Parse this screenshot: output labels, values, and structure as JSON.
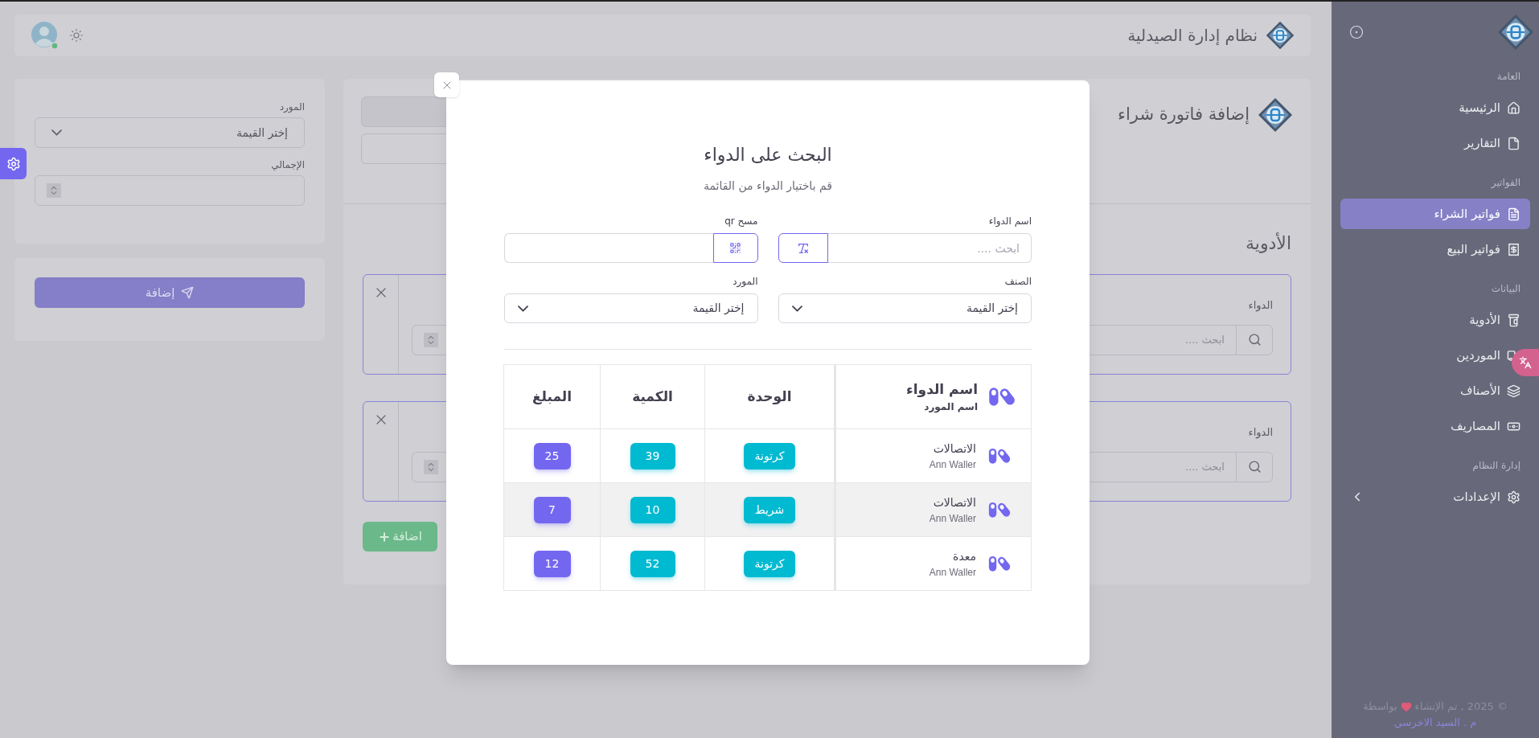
{
  "header": {
    "title": "نظام إدارة الصيدلية"
  },
  "sidebar": {
    "sections": [
      {
        "title": "العامة",
        "items": [
          {
            "label": "الرئيسية",
            "selected": false
          },
          {
            "label": "التقارير",
            "selected": false
          }
        ]
      },
      {
        "title": "الفواتير",
        "items": [
          {
            "label": "فواتير الشراء",
            "selected": true
          },
          {
            "label": "فواتير البيع",
            "selected": false
          }
        ]
      },
      {
        "title": "البيانات",
        "items": [
          {
            "label": "الأدوية",
            "selected": false
          },
          {
            "label": "الموردين",
            "selected": false
          },
          {
            "label": "الأصناف",
            "selected": false
          },
          {
            "label": "المصاريف",
            "selected": false
          }
        ]
      },
      {
        "title": "إدارة النظام",
        "items": [
          {
            "label": "الإعدادات",
            "selected": false,
            "expandable": true
          }
        ]
      }
    ],
    "footer": {
      "before": "© 2025 , تم الإنشاء",
      "after": "بواسطة",
      "author": "م . السيد الاخرسي"
    }
  },
  "left_panel": {
    "fields": [
      {
        "kind": "select",
        "label": "المورد",
        "value": "إختر القيمة"
      },
      {
        "kind": "number",
        "label": "الإجمالي"
      }
    ],
    "submit": "إضافة"
  },
  "invoice": {
    "title": "إضافة فاتورة شراء",
    "section_title": "الأدوية",
    "items": [
      {
        "label": "الدواء",
        "placeholder": "ابحث ...."
      },
      {
        "label": "الدواء",
        "placeholder": "ابحث ...."
      }
    ],
    "add_button": "اضافة"
  },
  "modal": {
    "title": "البحث على الدواء",
    "subtitle": "قم باختيار الدواء من القائمة",
    "fields": [
      {
        "kind": "search",
        "label": "اسم الدواء",
        "placeholder": "ابحث ...."
      },
      {
        "kind": "qr",
        "label": "مسح qr"
      },
      {
        "kind": "select",
        "label": "الصنف",
        "value": "إختر القيمة"
      },
      {
        "kind": "select",
        "label": "المورد",
        "value": "إختر القيمة"
      }
    ],
    "table": {
      "columns": [
        {
          "title": "اسم الدواء",
          "subtitle": "اسم المورد"
        },
        {
          "title": "الوحدة"
        },
        {
          "title": "الكمية"
        },
        {
          "title": "المبلغ"
        }
      ],
      "rows": [
        {
          "name": "الاتصالات",
          "supplier": "Ann Waller",
          "unit": "كرتونة",
          "quantity": "39",
          "amount": "25",
          "highlighted": false
        },
        {
          "name": "الاتصالات",
          "supplier": "Ann Waller",
          "unit": "شريط",
          "quantity": "10",
          "amount": "7",
          "highlighted": true
        },
        {
          "name": "معدة",
          "supplier": "Ann Waller",
          "unit": "كرتونة",
          "quantity": "52",
          "amount": "12",
          "highlighted": false
        }
      ]
    }
  }
}
